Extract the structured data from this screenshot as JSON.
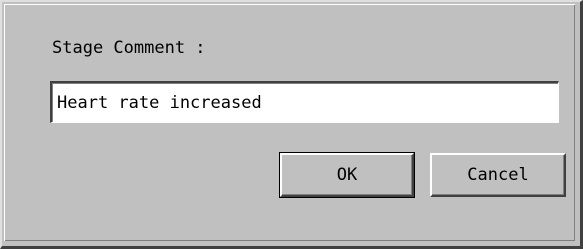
{
  "dialog": {
    "label": "Stage Comment :",
    "comment_value": "Heart rate increased",
    "ok_label": "OK",
    "cancel_label": "Cancel"
  }
}
